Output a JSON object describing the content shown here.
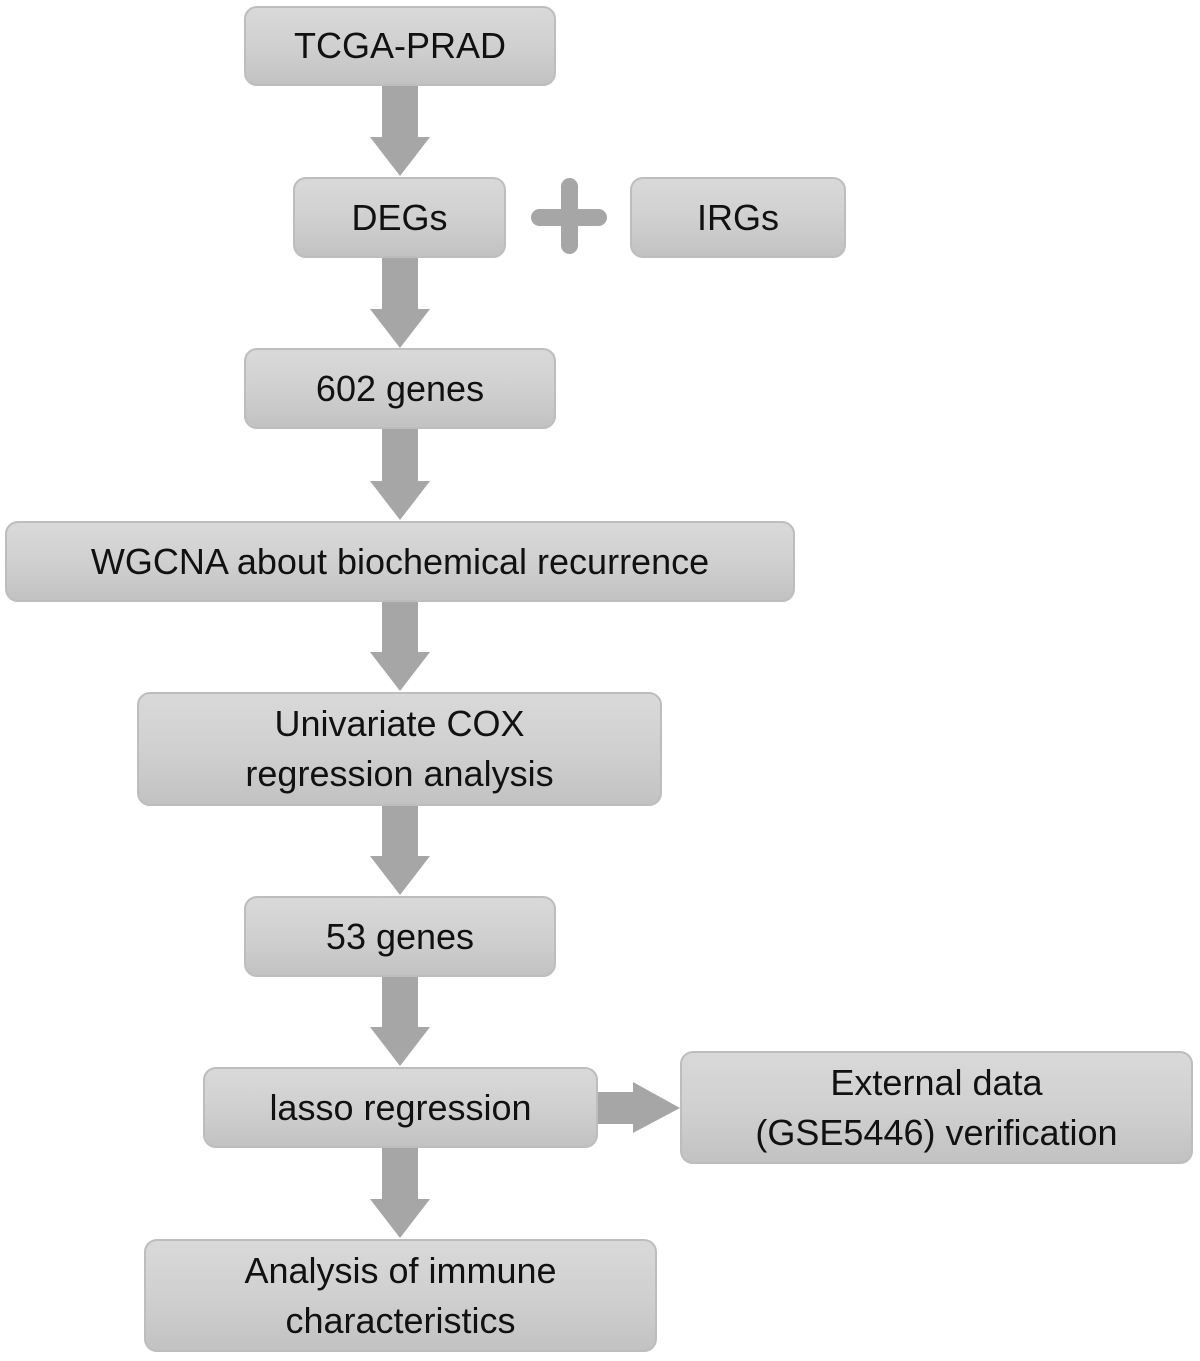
{
  "diagram": {
    "type": "flowchart",
    "nodes": {
      "tcga": {
        "lines": [
          "TCGA-PRAD"
        ]
      },
      "degs": {
        "lines": [
          "DEGs"
        ]
      },
      "irgs": {
        "lines": [
          "IRGs"
        ]
      },
      "plus_symbol": "+",
      "genes602": {
        "lines": [
          "602 genes"
        ]
      },
      "wgcna": {
        "lines": [
          "WGCNA about biochemical recurrence"
        ]
      },
      "univariate": {
        "lines": [
          "Univariate COX",
          "regression analysis"
        ]
      },
      "genes53": {
        "lines": [
          "53 genes"
        ]
      },
      "lasso": {
        "lines": [
          "lasso regression"
        ]
      },
      "external": {
        "lines": [
          "External data",
          "(GSE5446) verification"
        ]
      },
      "immune": {
        "lines": [
          "Analysis of immune",
          "characteristics"
        ]
      }
    },
    "edges": [
      {
        "from": "TCGA-PRAD",
        "to": "DEGs"
      },
      {
        "from": "DEGs + IRGs",
        "to": "602 genes"
      },
      {
        "from": "602 genes",
        "to": "WGCNA about biochemical recurrence"
      },
      {
        "from": "WGCNA about biochemical recurrence",
        "to": "Univariate COX regression analysis"
      },
      {
        "from": "Univariate COX regression analysis",
        "to": "53 genes"
      },
      {
        "from": "53 genes",
        "to": "lasso regression"
      },
      {
        "from": "lasso regression",
        "to": "External data (GSE5446) verification"
      },
      {
        "from": "lasso regression",
        "to": "Analysis of immune characteristics"
      }
    ],
    "colors": {
      "box_fill": "#d0d0d0",
      "box_border": "#bdbdbd",
      "arrow": "#a6a6a6",
      "text": "#111111"
    }
  }
}
